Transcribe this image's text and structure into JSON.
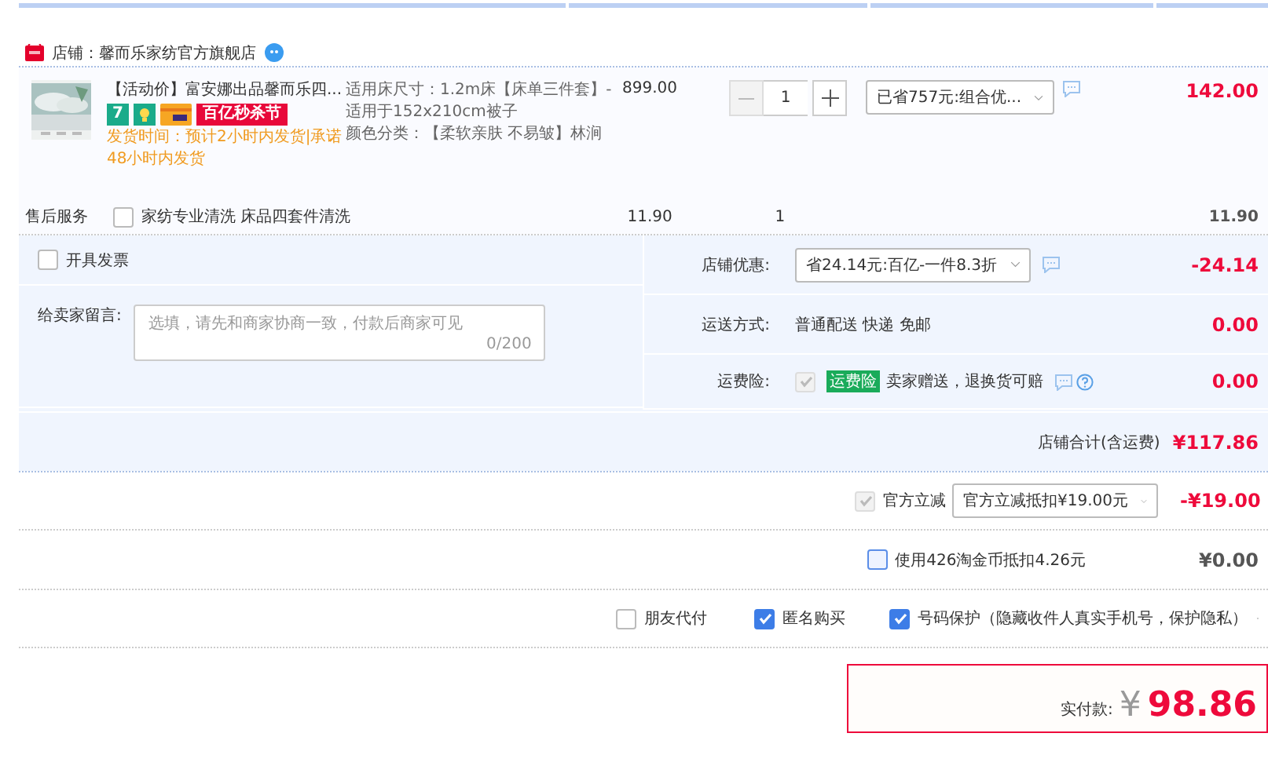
{
  "store": {
    "name": "店铺：馨而乐家纺官方旗舰店"
  },
  "item": {
    "title": "【活动价】富安娜出品馨而乐四...",
    "tags": [
      {
        "kind": "number",
        "text": "7"
      },
      {
        "kind": "icon"
      },
      {
        "kind": "card"
      },
      {
        "kind": "promo",
        "text": "百亿秒杀节"
      }
    ],
    "delivery": "发货时间：预计2小时内发货|承诺48小时内发货",
    "specs": [
      "适用床尺寸：1.2m床【床单三件套】-适用于152x210cm被子",
      "颜色分类：【柔软亲肤 不易皱】林涧"
    ],
    "price": "899.00",
    "quantity": "1",
    "discount": "已省757元:组合优...",
    "subtotal": "142.00"
  },
  "service": {
    "label": "售后服务",
    "checkbox": {
      "checked": false,
      "disabled": false
    },
    "text": "家纺专业清洗 床品四套件清洗",
    "price": "11.90",
    "quantity": "1",
    "total": "11.90"
  },
  "invoice": {
    "checkbox": {
      "checked": false,
      "disabled": false
    },
    "label": "开具发票"
  },
  "message": {
    "label": "给卖家留言:",
    "placeholder": "选填，请先和商家协商一致，付款后商家可见",
    "counter": "0/200"
  },
  "store_rows": [
    {
      "kind": "select",
      "label": "店铺优惠:",
      "select": "省24.14元:百亿-一件8.3折",
      "amount": "-24.14"
    },
    {
      "kind": "text",
      "label": "运送方式:",
      "value": "普通配送 快递 免邮",
      "amount": "0.00"
    },
    {
      "kind": "insurance",
      "label": "运费险:",
      "checkbox": {
        "checked": true,
        "disabled": true
      },
      "tag": "运费险",
      "value": "卖家赠送，退换货可赔",
      "amount": "0.00"
    }
  ],
  "store_total": {
    "label": "店铺合计(含运费)",
    "amount": "¥117.86"
  },
  "official": {
    "checkbox": {
      "checked": true,
      "disabled": true
    },
    "label": "官方立减",
    "select": "官方立减抵扣¥19.00元",
    "amount": "-¥19.00"
  },
  "coins": {
    "checkbox": {
      "checked": false,
      "disabled": false
    },
    "label": "使用426淘金币抵扣4.26元",
    "amount": "¥0.00"
  },
  "options": [
    {
      "label": "朋友代付",
      "checked": false
    },
    {
      "label": "匿名购买",
      "checked": true
    },
    {
      "label": "号码保护（隐藏收件人真实手机号，保护隐私）",
      "checked": true
    }
  ],
  "pay": {
    "label": "实付款:",
    "currency": "¥",
    "amount": "98.86"
  }
}
